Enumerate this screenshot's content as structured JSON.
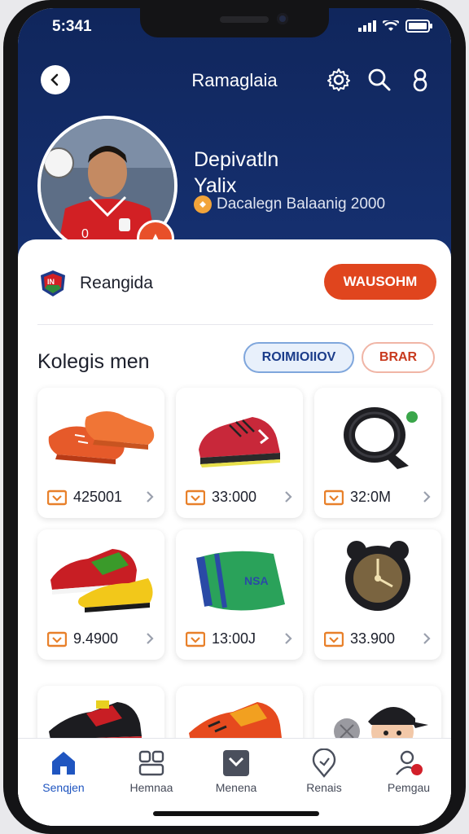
{
  "status": {
    "time": "5:341"
  },
  "appbar": {
    "title": "Ramaglaia"
  },
  "hero": {
    "name_line1": "Depivatln",
    "name_line2": "Yalix",
    "subtitle": "Dacalegn Balaanig 2000"
  },
  "team": {
    "name": "Reangida",
    "follow_label": "WAUSOHM"
  },
  "collection": {
    "title": "Kolegis men",
    "filter_primary": "ROIMIOIIOV",
    "filter_secondary": "BRAR"
  },
  "items": [
    {
      "price": "425001",
      "icon": "red-orange-sneakers"
    },
    {
      "price": "33:000",
      "icon": "red-sneaker"
    },
    {
      "price": "32:0M",
      "icon": "black-wristband"
    },
    {
      "price": "9.4900",
      "icon": "red-yellow-sneakers"
    },
    {
      "price": "13:00J",
      "icon": "green-bag"
    },
    {
      "price": "33.900",
      "icon": "black-watch"
    },
    {
      "price": "",
      "icon": "black-red-sneaker"
    },
    {
      "price": "",
      "icon": "orange-sneaker"
    },
    {
      "price": "",
      "icon": "figurine-with-cap"
    }
  ],
  "nav": {
    "items": [
      {
        "label": "Senqjen",
        "icon": "home-icon"
      },
      {
        "label": "Hemnaa",
        "icon": "people-icon"
      },
      {
        "label": "Menena",
        "icon": "media-icon"
      },
      {
        "label": "Renais",
        "icon": "location-icon"
      },
      {
        "label": "Pemgau",
        "icon": "profile-icon"
      }
    ],
    "active_index": 0
  },
  "colors": {
    "hero": "#132b68",
    "accent": "#e0451e",
    "active": "#1f55c0"
  }
}
